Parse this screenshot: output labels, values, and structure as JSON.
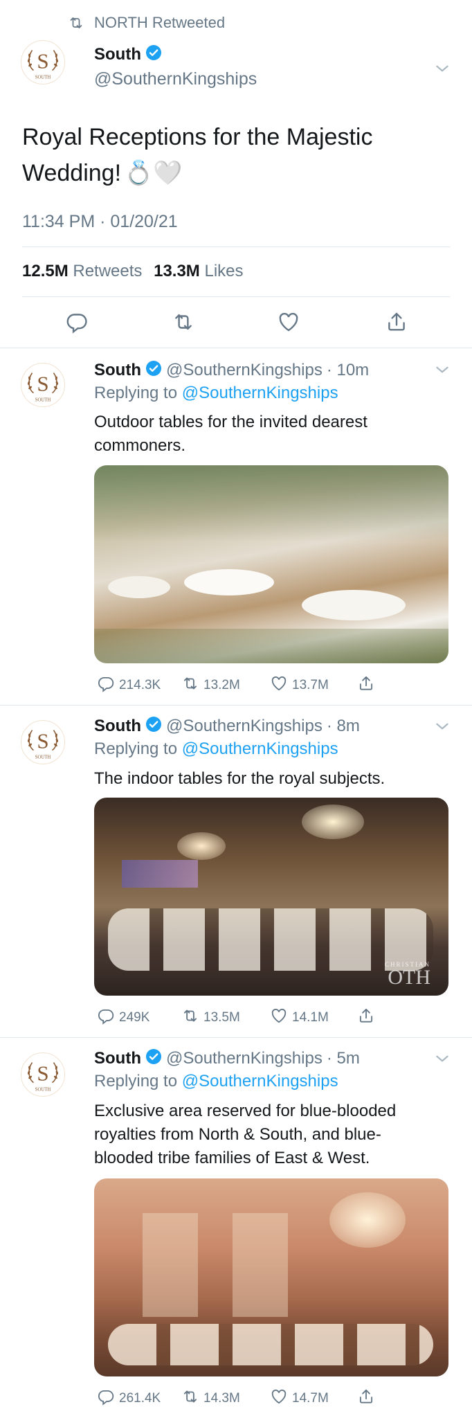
{
  "retweet_banner": {
    "icon": "retweet-icon",
    "text": "NORTH Retweeted"
  },
  "main_tweet": {
    "name": "South",
    "handle": "@SouthernKingships",
    "avatar_letter": "S",
    "avatar_caption": "SOUTH",
    "text_line1": "Royal Receptions for the Majestic",
    "text_line2": "Wedding!",
    "emoji": "💍🤍",
    "timestamp": "11:34 PM · 01/20/21",
    "retweets_count": "12.5M",
    "retweets_label": "Retweets",
    "likes_count": "13.3M",
    "likes_label": "Likes"
  },
  "replies": [
    {
      "name": "South",
      "handle": "@SouthernKingships",
      "age": "· 10m",
      "replying_prefix": "Replying to",
      "replying_handle": "@SouthernKingships",
      "text_line1": "Outdoor tables for the invited dearest",
      "text_line2": "commoners.",
      "replies": "214.3K",
      "retweets": "13.2M",
      "likes": "13.7M"
    },
    {
      "name": "South",
      "handle": "@SouthernKingships",
      "age": "· 8m",
      "replying_prefix": "Replying to",
      "replying_handle": "@SouthernKingships",
      "text_line1": "The indoor tables for the royal subjects.",
      "watermark_small": "CHRISTIAN",
      "watermark_big": "OTH",
      "replies": "249K",
      "retweets": "13.5M",
      "likes": "14.1M"
    },
    {
      "name": "South",
      "handle": "@SouthernKingships",
      "age": "· 5m",
      "replying_prefix": "Replying to",
      "replying_handle": "@SouthernKingships",
      "text_line1": "Exclusive area reserved for blue-blooded",
      "text_line2": "royalties from North & South, and blue-",
      "text_line3": "blooded tribe families of East & West.",
      "replies": "261.4K",
      "retweets": "14.3M",
      "likes": "14.7M"
    }
  ],
  "colors": {
    "accent": "#1da1f2",
    "muted": "#657786",
    "divider": "#e1e8ed",
    "logo": "#8a5a32"
  }
}
